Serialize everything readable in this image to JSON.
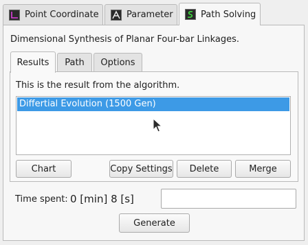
{
  "top_tabs": [
    {
      "label": "Point Coordinate",
      "icon": "point-coordinate-icon"
    },
    {
      "label": "Parameter",
      "icon": "parameter-icon"
    },
    {
      "label": "Path Solving",
      "icon": "path-solving-icon"
    }
  ],
  "description": "Dimensional Synthesis of Planar Four-bar Linkages.",
  "inner_tabs": [
    {
      "label": "Results"
    },
    {
      "label": "Path"
    },
    {
      "label": "Options"
    }
  ],
  "results": {
    "info": "This is the result from the algorithm.",
    "items": [
      "Differtial Evolution (1500 Gen)"
    ]
  },
  "buttons": {
    "chart": "Chart",
    "copy_settings": "Copy Settings",
    "delete": "Delete",
    "merge": "Merge",
    "generate": "Generate"
  },
  "time": {
    "label": "Time spent:",
    "value": "0 [min] 8 [s]"
  },
  "colors": {
    "selection": "#3d9ae6"
  }
}
